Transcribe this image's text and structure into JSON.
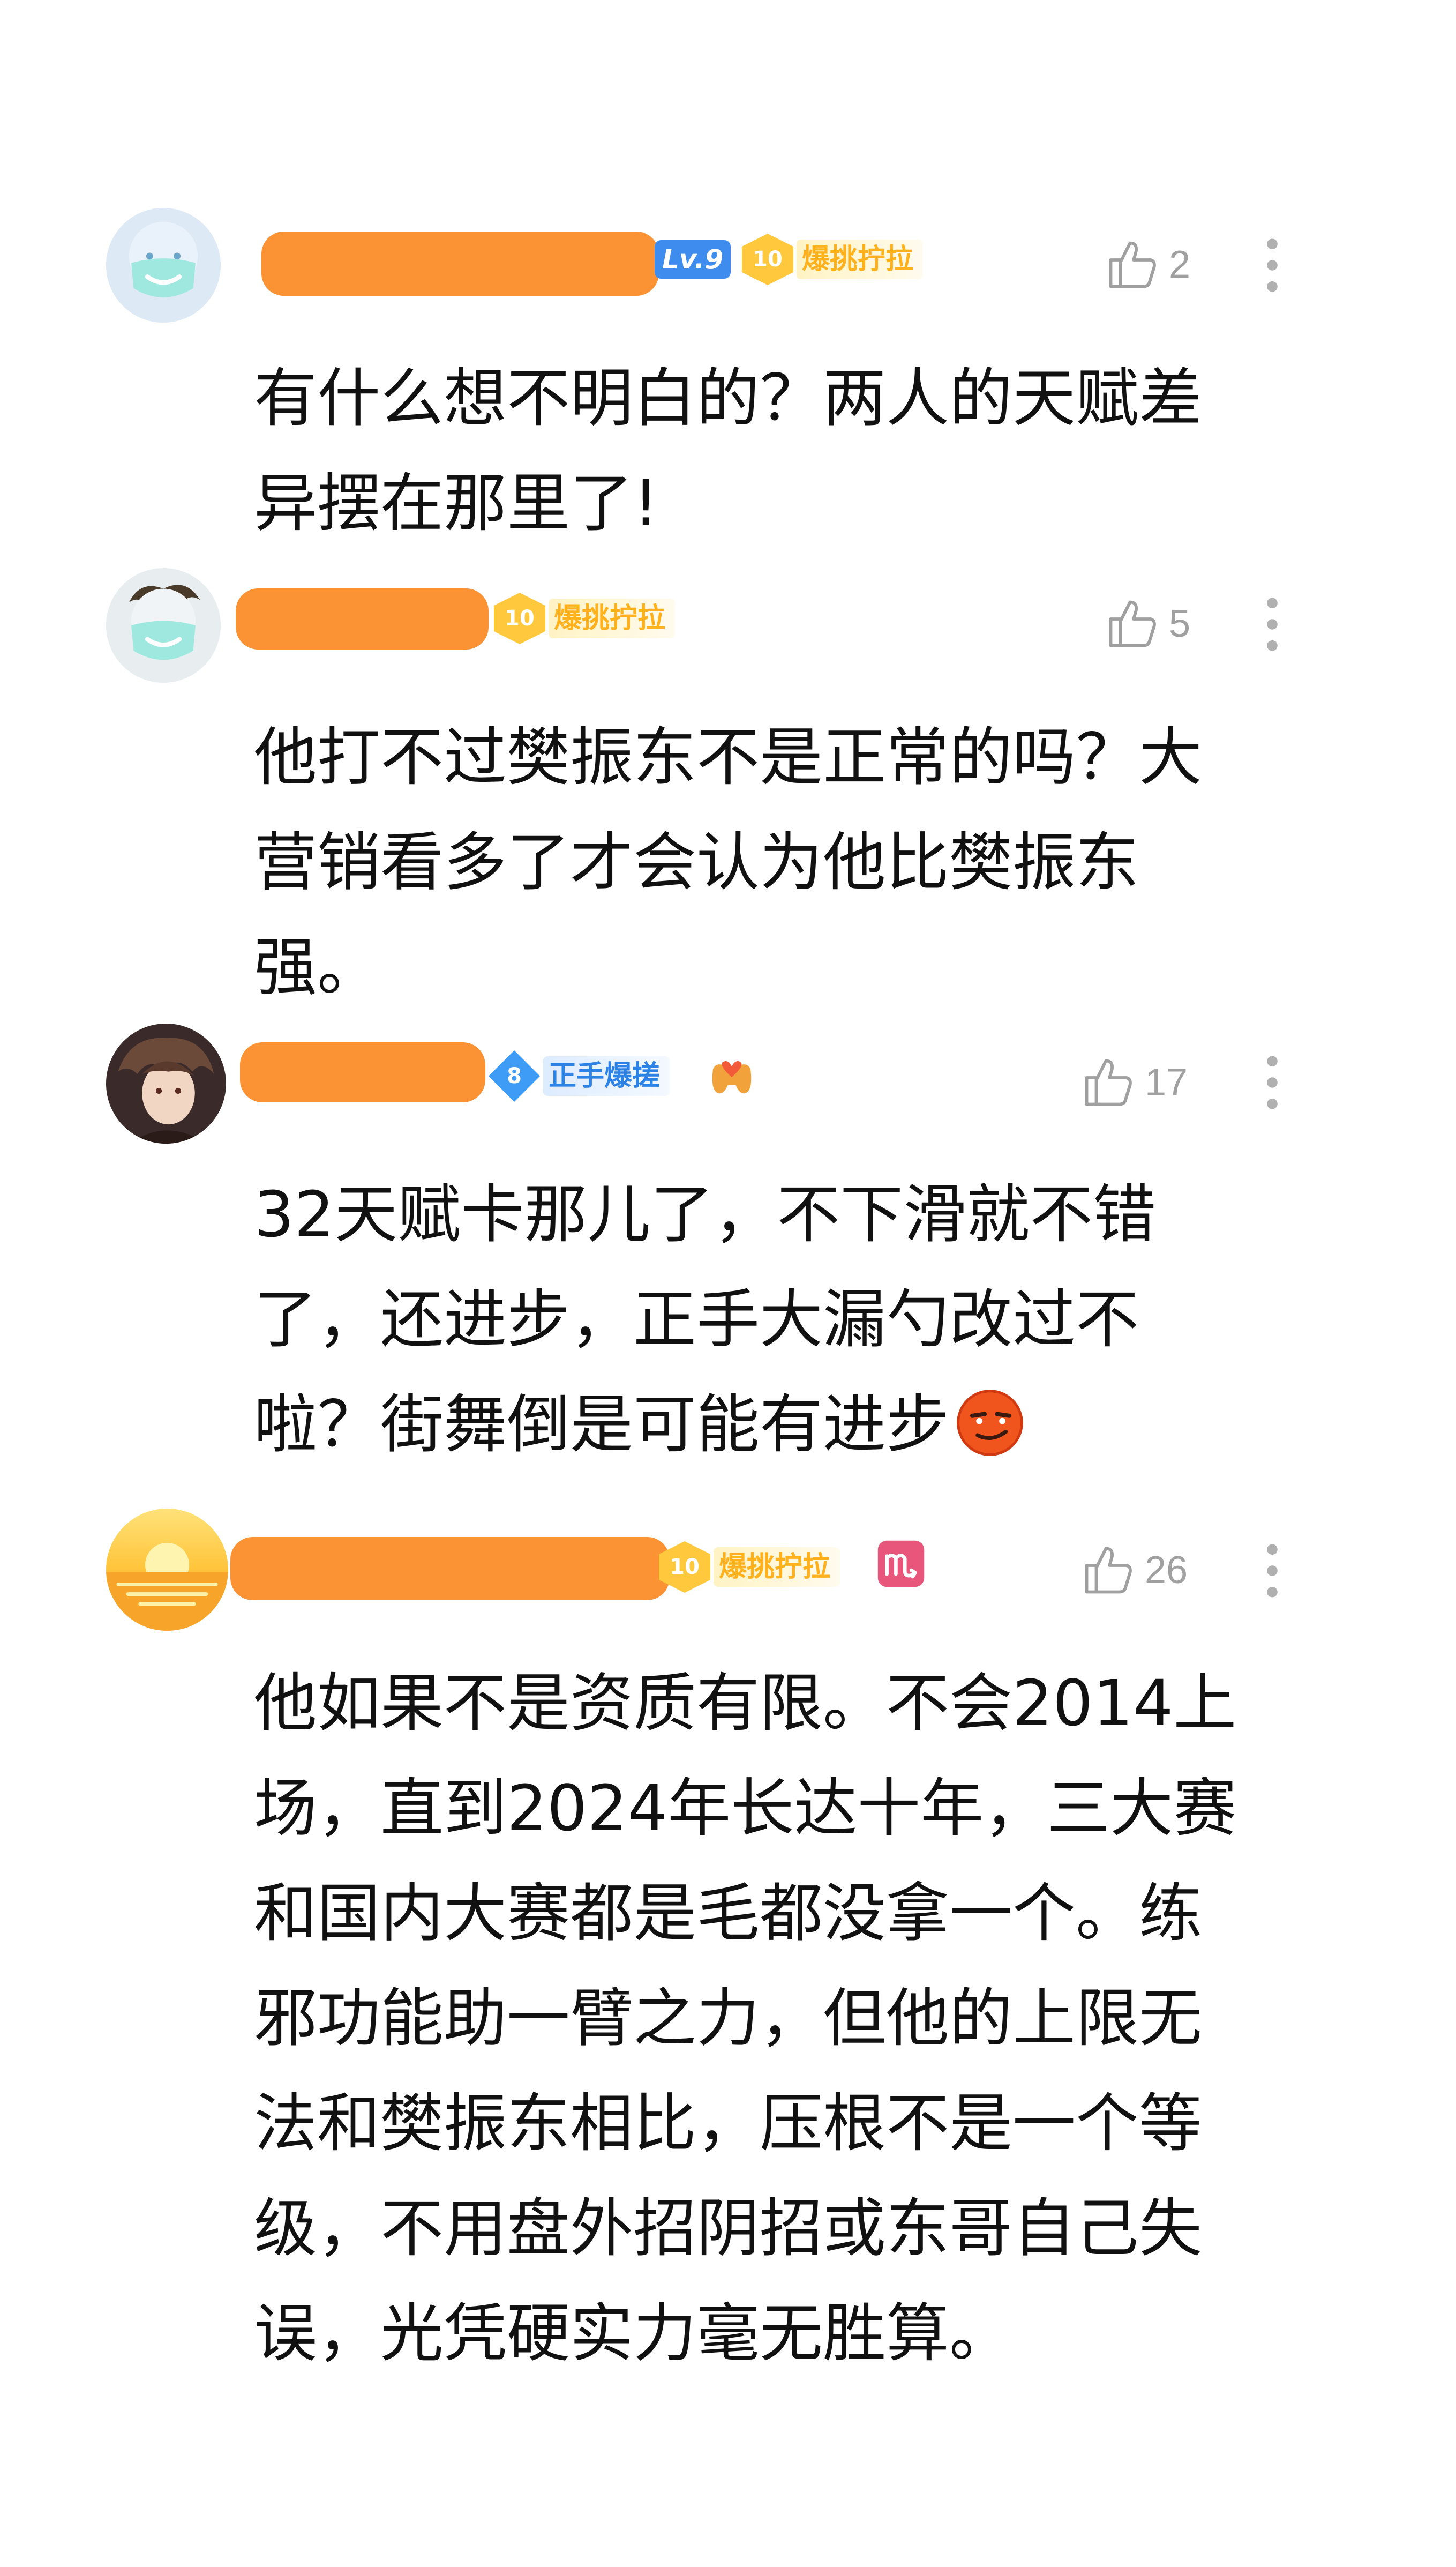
{
  "comments": [
    {
      "level": "Lv.9",
      "fan_badge": {
        "num": "10",
        "text": "爆挑拧拉",
        "style": "gold"
      },
      "likes": "2",
      "text": "有什么想不明白的？两人的天赋差\n异摆在那里了!"
    },
    {
      "fan_badge": {
        "num": "10",
        "text": "爆挑拧拉",
        "style": "gold"
      },
      "likes": "5",
      "text": "他打不过樊振东不是正常的吗？大\n营销看多了才会认为他比樊振东\n强。"
    },
    {
      "fan_badge": {
        "num": "8",
        "text": "正手爆搓",
        "style": "blue"
      },
      "extra_icon": "gamepad-heart-icon",
      "likes": "17",
      "text": "32天赋卡那儿了，不下滑就不错\n了，还进步，正手大漏勺改过不\n啦？街舞倒是可能有进步",
      "emoji": "smirk-emoji"
    },
    {
      "fan_badge": {
        "num": "10",
        "text": "爆挑拧拉",
        "style": "gold"
      },
      "extra_icon": "scorpio-icon",
      "likes": "26",
      "text": "他如果不是资质有限。不会2014上\n场，直到2024年长达十年，三大赛\n和国内大赛都是毛都没拿一个。练\n邪功能助一臂之力，但他的上限无\n法和樊振东相比，压根不是一个等\n级，不用盘外招阴招或东哥自己失\n误，光凭硬实力毫无胜算。"
    }
  ],
  "colors": {
    "redaction": "#fb9234",
    "like_gray": "#a0a0a0",
    "text": "#111111",
    "gold_badge": "#ffb11d",
    "blue_badge": "#2d82e6"
  }
}
